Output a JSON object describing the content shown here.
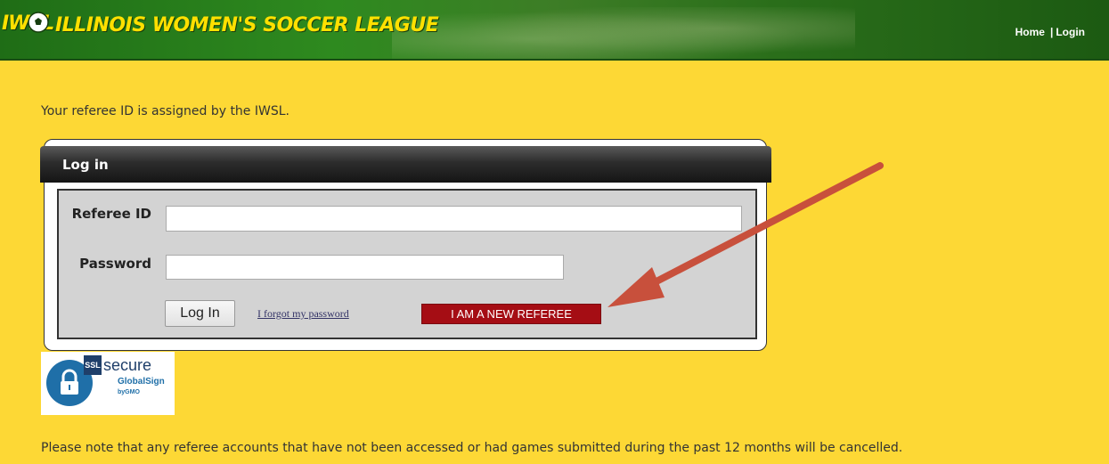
{
  "header": {
    "logo_text": "IWSL",
    "title": "ILLINOIS WOMEN'S SOCCER LEAGUE",
    "nav": {
      "home": "Home",
      "separator": "|",
      "login": "Login"
    }
  },
  "intro_text": "Your referee ID is assigned by the IWSL.",
  "login": {
    "heading": "Log in",
    "referee_id_label": "Referee ID",
    "password_label": "Password",
    "referee_id_value": "",
    "password_value": "",
    "submit_label": "Log In",
    "forgot_link": "I forgot my password",
    "new_referee_button": "I AM A NEW REFEREE"
  },
  "ssl_badge": {
    "tag": "SSL",
    "secure": "secure",
    "brand": "GlobalSign",
    "sub": "byGMO"
  },
  "notice_text": "Please note that any referee accounts that have not been accessed or had games submitted during the past 12 months will be cancelled.",
  "colors": {
    "page_bg": "#fdd835",
    "banner_green": "#2e8a1f",
    "title_yellow": "#ffe000",
    "new_referee_red": "#a50d14",
    "arrow_red": "#c8503c"
  }
}
